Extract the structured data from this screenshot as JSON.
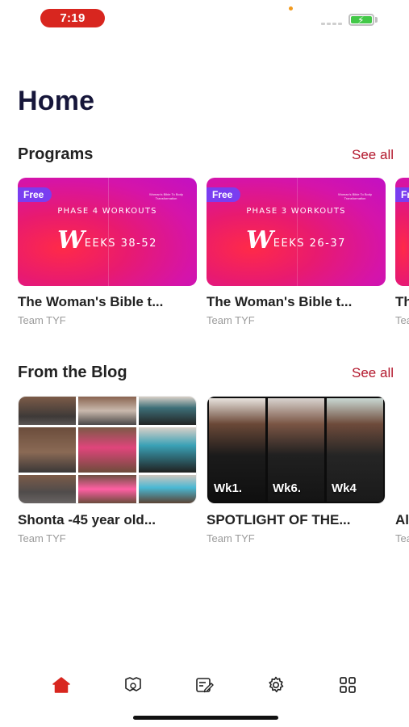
{
  "status_bar": {
    "time": "7:19"
  },
  "page": {
    "title": "Home"
  },
  "programs": {
    "section_title": "Programs",
    "see_all_label": "See all",
    "cards": [
      {
        "badge": "Free",
        "thumb_caption": "Woman's Bible To Body Transformation",
        "thumb_phase": "PHASE 4 WORKOUTS",
        "thumb_weeks_script": "W",
        "thumb_weeks_rest": "EEKS 38-52",
        "title": "The Woman's Bible t...",
        "author": "Team TYF"
      },
      {
        "badge": "Free",
        "thumb_caption": "Woman's Bible To Body Transformation",
        "thumb_phase": "PHASE 3 WORKOUTS",
        "thumb_weeks_script": "W",
        "thumb_weeks_rest": "EEKS 26-37",
        "title": "The Woman's Bible t...",
        "author": "Team TYF"
      },
      {
        "badge": "Fr",
        "title": "Th",
        "author": "Tea"
      }
    ]
  },
  "blog": {
    "section_title": "From the Blog",
    "see_all_label": "See all",
    "posts": [
      {
        "title": "Shonta -45 year old...",
        "author": "Team TYF"
      },
      {
        "title": "SPOTLIGHT  OF THE...",
        "author": "Team TYF",
        "week_labels": [
          "Wk1.",
          "Wk6.",
          "Wk4"
        ]
      },
      {
        "title": "Al",
        "author": "Tea"
      }
    ]
  },
  "tab_bar": {
    "items": [
      {
        "icon": "home-icon",
        "active": true
      },
      {
        "icon": "programs-icon",
        "active": false
      },
      {
        "icon": "journal-icon",
        "active": false
      },
      {
        "icon": "gear-icon",
        "active": false
      },
      {
        "icon": "grid-icon",
        "active": false
      }
    ]
  },
  "colors": {
    "accent": "#b3182d",
    "title": "#16163a",
    "active_tab": "#d8261f",
    "badge": "#7a3df0"
  }
}
